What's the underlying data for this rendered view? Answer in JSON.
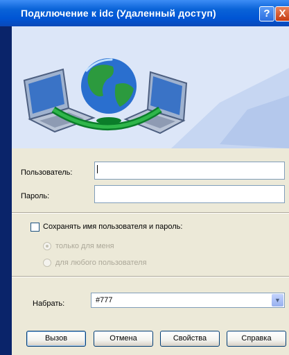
{
  "window": {
    "title": "Подключение к idc (Удаленный доступ)",
    "help_label": "?",
    "close_label": "X"
  },
  "form": {
    "username_label": "Пользователь:",
    "username_value": "",
    "password_label": "Пароль:",
    "password_value": "",
    "save_checkbox_label": "Сохранять имя пользователя и пароль:",
    "save_checked": false,
    "radio_only_me": "только для меня",
    "radio_anyone": "для любого пользователя",
    "dial_label": "Набрать:",
    "dial_value": "#777"
  },
  "buttons": {
    "call": "Вызов",
    "cancel": "Отмена",
    "properties": "Свойства",
    "help": "Справка"
  },
  "colors": {
    "titlebar": "#0055d4",
    "dialog_bg": "#ece9d8",
    "banner_bg": "#dfe8fa"
  }
}
